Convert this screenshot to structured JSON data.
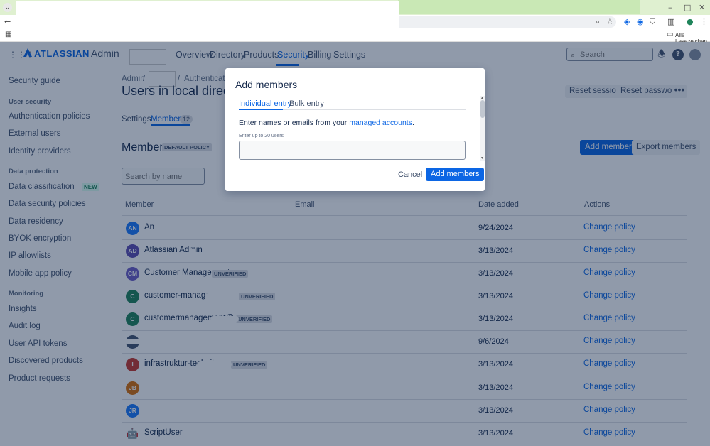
{
  "browser": {
    "bookmarks_label": "Alle Lesezeichen"
  },
  "nav": {
    "logo": "ATLASSIAN",
    "admin": "Admin",
    "items": [
      "Overview",
      "Directory",
      "Products",
      "Security",
      "Billing",
      "Settings"
    ],
    "active": "Security",
    "search_placeholder": "Search"
  },
  "sidebar": {
    "items": [
      {
        "type": "item",
        "label": "Security guide"
      },
      {
        "type": "section",
        "label": "User security"
      },
      {
        "type": "item",
        "label": "Authentication policies"
      },
      {
        "type": "item",
        "label": "External users"
      },
      {
        "type": "item",
        "label": "Identity providers"
      },
      {
        "type": "section",
        "label": "Data protection"
      },
      {
        "type": "item",
        "label": "Data classification",
        "badge": "NEW"
      },
      {
        "type": "item",
        "label": "Data security policies"
      },
      {
        "type": "item",
        "label": "Data residency"
      },
      {
        "type": "item",
        "label": "BYOK encryption"
      },
      {
        "type": "item",
        "label": "IP allowlists"
      },
      {
        "type": "item",
        "label": "Mobile app policy"
      },
      {
        "type": "section",
        "label": "Monitoring"
      },
      {
        "type": "item",
        "label": "Insights"
      },
      {
        "type": "item",
        "label": "Audit log"
      },
      {
        "type": "item",
        "label": "User API tokens"
      },
      {
        "type": "item",
        "label": "Discovered products"
      },
      {
        "type": "item",
        "label": "Product requests"
      }
    ]
  },
  "main": {
    "breadcrumb": [
      "Admin",
      "Authentication"
    ],
    "title": "Users in local directory",
    "reset_sessions": "Reset sessions",
    "reset_passwords": "Reset passwords",
    "more": "•••",
    "tabs": {
      "settings": "Settings",
      "members": "Members",
      "members_count": "12"
    },
    "members_heading": "Members",
    "default_policy": "DEFAULT POLICY",
    "add_members": "Add members",
    "export_members": "Export members",
    "name_search_placeholder": "Search by name"
  },
  "table": {
    "headers": [
      "Member",
      "Email",
      "Date added",
      "Actions"
    ],
    "rows": [
      {
        "initials": "AN",
        "color": "#1d7afc",
        "name": "An",
        "unverified": false,
        "date": "9/24/2024",
        "action": "Change policy"
      },
      {
        "initials": "AD",
        "color": "#5e4db2",
        "name": "Atlassian Admin",
        "unverified": false,
        "date": "3/13/2024",
        "action": "Change policy"
      },
      {
        "initials": "CM",
        "color": "#6e5dc6",
        "name": "Customer Management",
        "unverified": true,
        "date": "3/13/2024",
        "action": "Change policy"
      },
      {
        "initials": "C",
        "color": "#1f845a",
        "name": "customer-managemen",
        "unverified": true,
        "date": "3/13/2024",
        "action": "Change policy"
      },
      {
        "initials": "C",
        "color": "#1f845a",
        "name": "customermanagement@",
        "unverified": true,
        "date": "3/13/2024",
        "action": "Change policy"
      },
      {
        "initials": "",
        "color": "#44546f",
        "name": "",
        "unverified": false,
        "date": "9/6/2024",
        "action": "Change policy"
      },
      {
        "initials": "I",
        "color": "#c9372c",
        "name": "infrastruktur-technik",
        "unverified": true,
        "date": "3/13/2024",
        "action": "Change policy"
      },
      {
        "initials": "JB",
        "color": "#d97008",
        "name": "",
        "unverified": false,
        "date": "3/13/2024",
        "action": "Change policy"
      },
      {
        "initials": "JR",
        "color": "#1d7afc",
        "name": "",
        "unverified": false,
        "date": "3/13/2024",
        "action": "Change policy"
      },
      {
        "initials": "",
        "color": "#626f86",
        "name": "ScriptUser",
        "unverified": false,
        "date": "3/13/2024",
        "action": "Change policy",
        "robot": true
      }
    ],
    "unverified_label": "UNVERIFIED"
  },
  "modal": {
    "title": "Add members",
    "tab_individual": "Individual entry",
    "tab_bulk": "Bulk entry",
    "text_before": "Enter names or emails from your ",
    "link": "managed accounts",
    "text_after": ".",
    "hint": "Enter up to 20 users",
    "cancel": "Cancel",
    "submit": "Add members"
  }
}
